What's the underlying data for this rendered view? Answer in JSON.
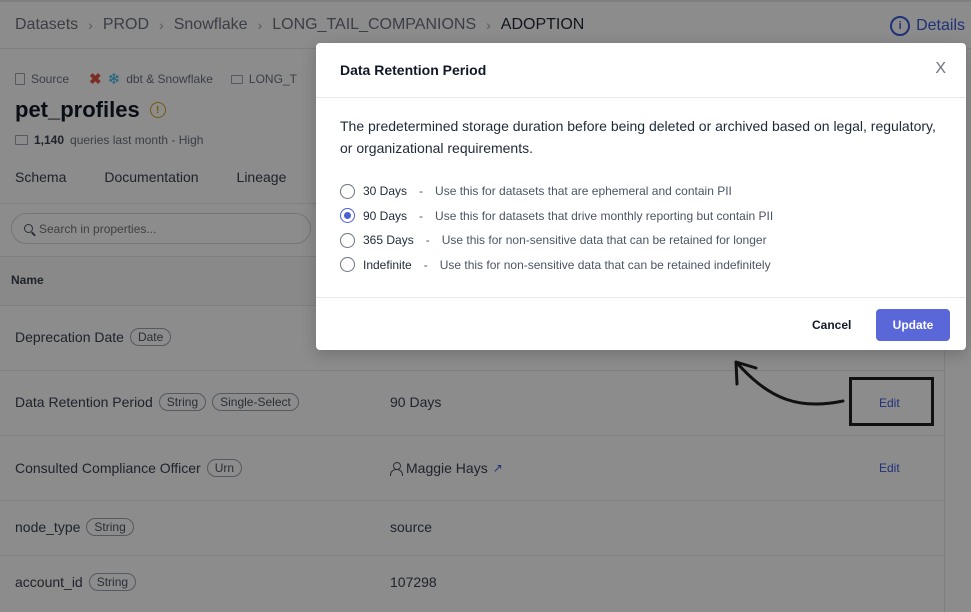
{
  "breadcrumb": {
    "items": [
      "Datasets",
      "PROD",
      "Snowflake",
      "LONG_TAIL_COMPANIONS",
      "ADOPTION"
    ],
    "separator": "›",
    "details_label": "Details"
  },
  "entity": {
    "type_label": "Source",
    "platform_label": "dbt & Snowflake",
    "container_label": "LONG_T",
    "name": "pet_profiles",
    "queries_count": "1,140",
    "queries_text": "queries last month - High"
  },
  "tabs": [
    "Schema",
    "Documentation",
    "Lineage"
  ],
  "search": {
    "placeholder": "Search in properties..."
  },
  "table": {
    "header_name": "Name",
    "rows": [
      {
        "name": "Deprecation Date",
        "tags": [
          "Date"
        ],
        "value": "",
        "edit": ""
      },
      {
        "name": "Data Retention Period",
        "tags": [
          "String",
          "Single-Select"
        ],
        "value": "90 Days",
        "edit": "Edit"
      },
      {
        "name": "Consulted Compliance Officer",
        "tags": [
          "Urn"
        ],
        "value": "Maggie Hays",
        "edit": "Edit"
      },
      {
        "name": "node_type",
        "tags": [
          "String"
        ],
        "value": "source",
        "edit": ""
      },
      {
        "name": "account_id",
        "tags": [
          "String"
        ],
        "value": "107298",
        "edit": ""
      }
    ]
  },
  "modal": {
    "title": "Data Retention Period",
    "close": "X",
    "description": "The predetermined storage duration before being deleted or archived based on legal, regulatory, or organizational requirements.",
    "options": [
      {
        "label": "30 Days",
        "desc": "Use this for datasets that are ephemeral and contain PII",
        "checked": false
      },
      {
        "label": "90 Days",
        "desc": "Use this for datasets that drive monthly reporting but contain PII",
        "checked": true
      },
      {
        "label": "365 Days",
        "desc": "Use this for non-sensitive data that can be retained for longer",
        "checked": false
      },
      {
        "label": "Indefinite",
        "desc": "Use this for non-sensitive data that can be retained indefinitely",
        "checked": false
      }
    ],
    "cancel_label": "Cancel",
    "update_label": "Update"
  },
  "colors": {
    "accent": "#5a67d8",
    "link": "#3b5bdb",
    "overlay": "rgba(0,0,0,0.45)"
  }
}
